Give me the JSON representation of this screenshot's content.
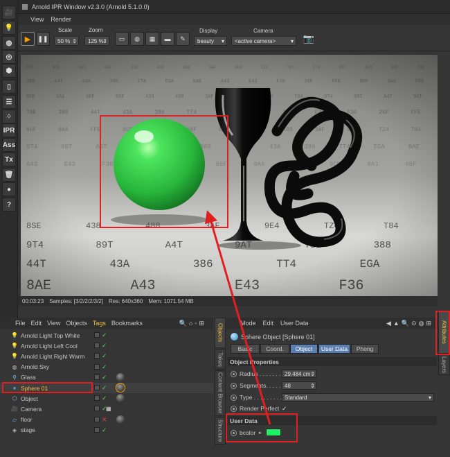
{
  "window": {
    "title": "Arnold IPR Window v2.3.0 (Arnold 5.1.0.0)"
  },
  "menu": [
    "View",
    "Render"
  ],
  "controls": {
    "scale_label": "Scale",
    "scale_value": "50 %",
    "zoom_label": "Zoom",
    "zoom_value": "125 %",
    "display_label": "Display",
    "display_value": "beauty",
    "camera_label": "Camera",
    "camera_value": "<active camera>"
  },
  "left_toolbar": {
    "ipr": "IPR",
    "ass": "Ass",
    "tx": "Tx",
    "help": "?"
  },
  "status": {
    "time": "00:03:23",
    "samples": "Samples: [3/2/2/2/3/2]",
    "res": "Res: 640x360",
    "mem": "Mem: 1071.54 MB"
  },
  "object_manager": {
    "menu": [
      "File",
      "Edit",
      "View",
      "Objects",
      "Tags",
      "Bookmarks"
    ],
    "objects": [
      {
        "name": "Arnold Light Top White"
      },
      {
        "name": "Arnold Light Left Cool"
      },
      {
        "name": "Arnold Light Right Warm"
      },
      {
        "name": "Arnold Sky"
      },
      {
        "name": "Glass"
      },
      {
        "name": "Sphere 01"
      },
      {
        "name": "Object"
      },
      {
        "name": "Camera"
      },
      {
        "name": "floor"
      },
      {
        "name": "stage"
      }
    ]
  },
  "side_tabs": {
    "left": [
      "Objects",
      "Takes",
      "Content Browser",
      "Structure"
    ],
    "right": [
      "Attributes",
      "Layers"
    ]
  },
  "attributes": {
    "menu": [
      "Mode",
      "Edit",
      "User Data"
    ],
    "header": "Sphere Object [Sphere 01]",
    "tabs": [
      "Basic",
      "Coord.",
      "Object",
      "User Data",
      "Phong"
    ],
    "section_object": "Object Properties",
    "radius_label": "Radius . . . . . . . .",
    "radius_value": "29.484 cm",
    "segments_label": "Segments. . . . . .",
    "segments_value": "48",
    "type_label": "Type . . . . . . . . . .",
    "type_value": "Standard",
    "render_perfect_label": "Render Perfect",
    "section_user": "User Data",
    "bcolor_label": "bcolor",
    "bcolor_hex": "#1ef06a"
  },
  "render_numbers": [
    "FFE",
    "9CE",
    "6A1",
    "68F",
    "8SE",
    "438",
    "488",
    "3AF",
    "9E4",
    "TZ4",
    "T84",
    "9T4",
    "89T",
    "A4T",
    "9AT",
    "T8E",
    "388",
    "44T",
    "43A",
    "386",
    "TT4",
    "EGA",
    "8AE",
    "A43",
    "E43",
    "F36",
    "26F",
    "FFE",
    "96F",
    "9A6"
  ]
}
